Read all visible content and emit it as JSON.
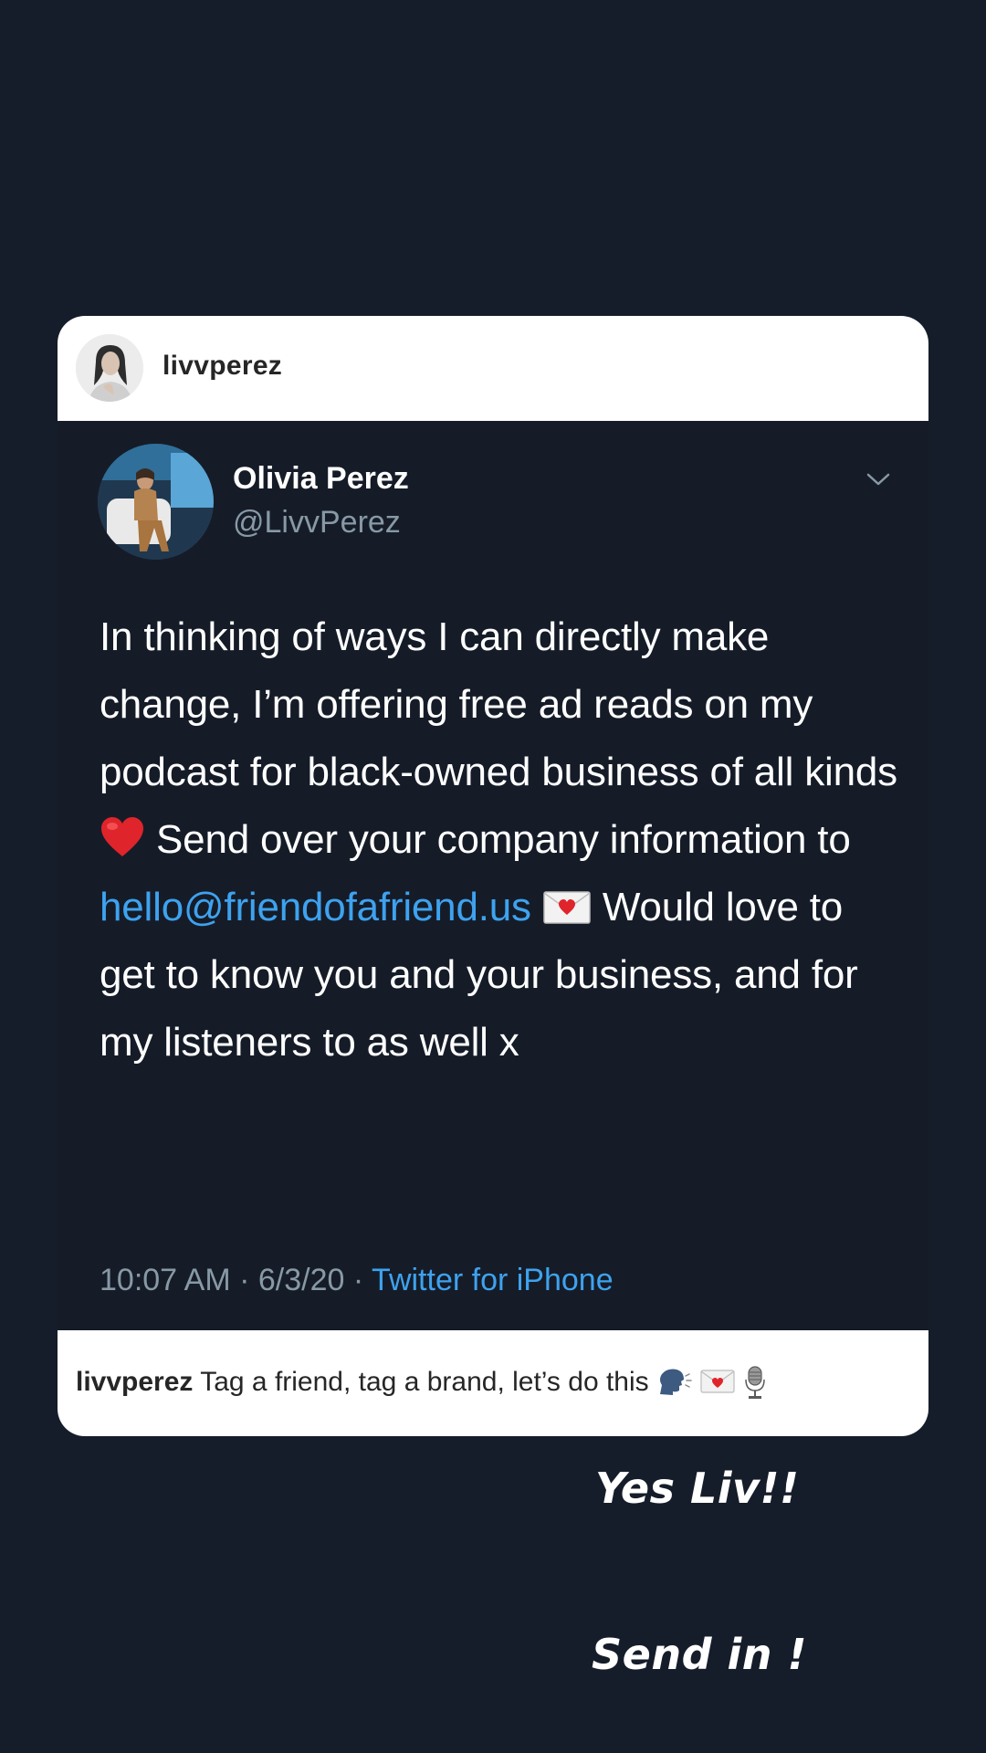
{
  "post": {
    "username": "livvperez",
    "caption_username": "livvperez",
    "caption_text": "Tag a friend, tag a brand, let’s do this"
  },
  "tweet": {
    "name": "Olivia Perez",
    "handle": "@LivvPerez",
    "text_1": "In thinking of ways I can directly make change, I’m offering free ad reads on my podcast for black-owned business of all kinds",
    "text_2": "Send over your company information to",
    "email": "hello@friendofafriend.us",
    "text_3": "Would love to get to know you and your business, and for my listeners to as well x",
    "time": "10:07 AM",
    "separator": "·",
    "date": "6/3/20",
    "source": "Twitter for iPhone"
  },
  "overlays": {
    "line1": "Yes Liv!!",
    "line2": "Send in !"
  },
  "icons": {
    "heart": "red-heart-icon",
    "love_letter": "love-letter-icon",
    "speaking_head": "speaking-head-icon",
    "microphone": "studio-microphone-icon",
    "caret": "chevron-down-icon"
  },
  "colors": {
    "background": "#161d2a",
    "link": "#3ea2ef",
    "muted": "#8899a6"
  }
}
